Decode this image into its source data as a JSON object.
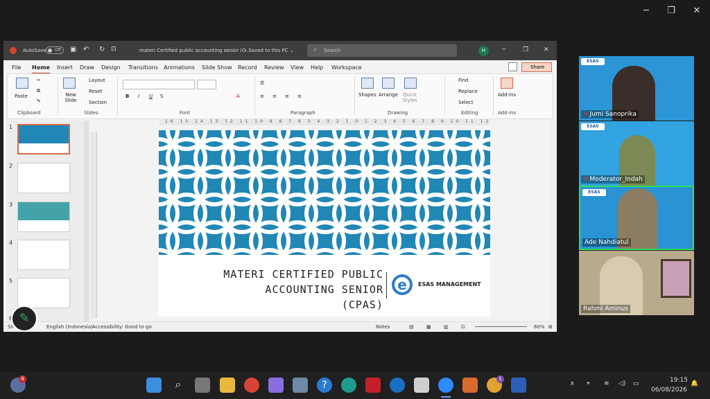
{
  "window": {
    "minimize": "─",
    "restore": "❐",
    "close": "✕"
  },
  "ppt": {
    "autosave_label": "AutoSave",
    "autosave_state": "Off",
    "doc_title": "materi Certified public accounting senior (C...",
    "saved_status": "• Saved to this PC ⌄",
    "search_placeholder": "Search",
    "avatar_initial": "H",
    "menu": [
      "File",
      "Home",
      "Insert",
      "Draw",
      "Design",
      "Transitions",
      "Animations",
      "Slide Show",
      "Record",
      "Review",
      "View",
      "Help",
      "Workspace"
    ],
    "share": "Share",
    "ribbon": {
      "clipboard": {
        "paste": "Paste",
        "group": "Clipboard"
      },
      "slides": {
        "new_slide": "New Slide",
        "layout": "Layout",
        "reset": "Reset",
        "section": "Section",
        "group": "Slides"
      },
      "font": {
        "group": "Font"
      },
      "paragraph": {
        "group": "Paragraph"
      },
      "drawing": {
        "shapes": "Shapes",
        "arrange": "Arrange",
        "quick_styles": "Quick Styles",
        "group": "Drawing"
      },
      "editing": {
        "find": "Find",
        "replace": "Replace",
        "select": "Select",
        "group": "Editing"
      },
      "addins": {
        "label": "Add-ins",
        "group": "Add-ins"
      }
    },
    "ruler_text": "16 15 14 13 12 11 10 9 8 7 6 5 4 3 2 1 0 1 2 3 4 5 6 7 8 9 10 11 12 13 14 15 16",
    "thumbnails": [
      "1",
      "2",
      "3",
      "4",
      "5",
      "6"
    ],
    "slide": {
      "title_line1": "MATERI CERTIFIED PUBLIC",
      "title_line2": "ACCOUNTING SENIOR (CPAS)",
      "logo_letter": "e",
      "brand": "ESAS MANAGEMENT"
    },
    "status": {
      "slide_prefix": "Sli",
      "language": "English (Indonesia)",
      "accessibility": "Accessibility: Good to go",
      "notes": "Notes",
      "zoom": "60%"
    }
  },
  "participants": [
    {
      "name": "Jumi Sanoprika",
      "muted": true
    },
    {
      "name": "Moderator_Indah",
      "muted": true
    },
    {
      "name": "Ade Nahdiatul",
      "muted": false
    },
    {
      "name": "Rahmi Aminus",
      "muted": false
    }
  ],
  "esas_badge": "ESAS",
  "taskbar": {
    "weather_badge": "4",
    "copilot_badge": "1",
    "time": "19:15",
    "date": "06/08/2026"
  },
  "colors": {
    "accent": "#c43e1c",
    "slide_blue": "#2187b5",
    "active_speaker": "#2fe05a"
  }
}
